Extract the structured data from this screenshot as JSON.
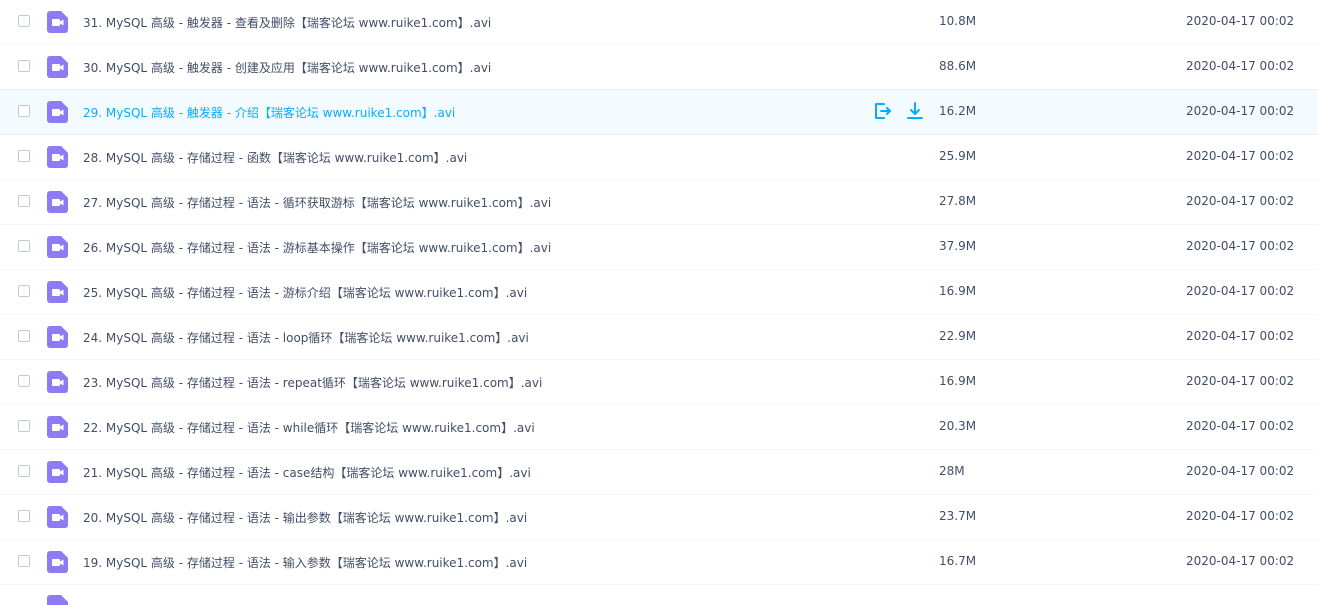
{
  "colors": {
    "accent": "#09aaff",
    "icon": "#8e7af3",
    "text": "#424e67"
  },
  "icons": {
    "file": "video-file-icon",
    "share": "share-icon",
    "download": "download-icon"
  },
  "rows": [
    {
      "name": "31. MySQL 高级 - 触发器 - 查看及删除【瑞客论坛 www.ruike1.com】.avi",
      "size": "10.8M",
      "date": "2020-04-17 00:02"
    },
    {
      "name": "30. MySQL 高级 - 触发器 - 创建及应用【瑞客论坛 www.ruike1.com】.avi",
      "size": "88.6M",
      "date": "2020-04-17 00:02"
    },
    {
      "name": "29. MySQL 高级 - 触发器 - 介绍【瑞客论坛 www.ruike1.com】.avi",
      "size": "16.2M",
      "date": "2020-04-17 00:02"
    },
    {
      "name": "28. MySQL 高级 - 存储过程 - 函数【瑞客论坛 www.ruike1.com】.avi",
      "size": "25.9M",
      "date": "2020-04-17 00:02"
    },
    {
      "name": "27. MySQL 高级 - 存储过程 - 语法 - 循环获取游标【瑞客论坛 www.ruike1.com】.avi",
      "size": "27.8M",
      "date": "2020-04-17 00:02"
    },
    {
      "name": "26. MySQL 高级 - 存储过程 - 语法 - 游标基本操作【瑞客论坛 www.ruike1.com】.avi",
      "size": "37.9M",
      "date": "2020-04-17 00:02"
    },
    {
      "name": "25. MySQL 高级 - 存储过程 - 语法 - 游标介绍【瑞客论坛 www.ruike1.com】.avi",
      "size": "16.9M",
      "date": "2020-04-17 00:02"
    },
    {
      "name": "24. MySQL 高级 - 存储过程 - 语法 - loop循环【瑞客论坛 www.ruike1.com】.avi",
      "size": "22.9M",
      "date": "2020-04-17 00:02"
    },
    {
      "name": "23. MySQL 高级 - 存储过程 - 语法 - repeat循环【瑞客论坛 www.ruike1.com】.avi",
      "size": "16.9M",
      "date": "2020-04-17 00:02"
    },
    {
      "name": "22. MySQL 高级 - 存储过程 - 语法 - while循环【瑞客论坛 www.ruike1.com】.avi",
      "size": "20.3M",
      "date": "2020-04-17 00:02"
    },
    {
      "name": "21. MySQL 高级 - 存储过程 - 语法 - case结构【瑞客论坛 www.ruike1.com】.avi",
      "size": "28M",
      "date": "2020-04-17 00:02"
    },
    {
      "name": "20. MySQL 高级 - 存储过程 - 语法 - 输出参数【瑞客论坛 www.ruike1.com】.avi",
      "size": "23.7M",
      "date": "2020-04-17 00:02"
    },
    {
      "name": "19. MySQL 高级 - 存储过程 - 语法 - 输入参数【瑞客论坛 www.ruike1.com】.avi",
      "size": "16.7M",
      "date": "2020-04-17 00:02"
    }
  ]
}
